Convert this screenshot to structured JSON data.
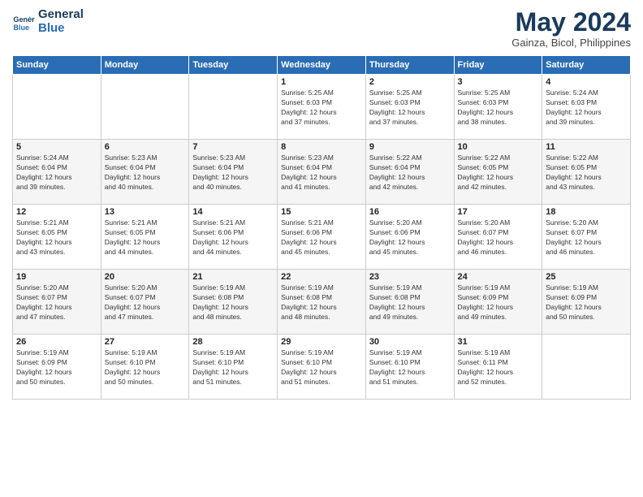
{
  "logo": {
    "line1": "General",
    "line2": "Blue"
  },
  "title": "May 2024",
  "subtitle": "Gainza, Bicol, Philippines",
  "days_header": [
    "Sunday",
    "Monday",
    "Tuesday",
    "Wednesday",
    "Thursday",
    "Friday",
    "Saturday"
  ],
  "weeks": [
    [
      {
        "day": "",
        "info": ""
      },
      {
        "day": "",
        "info": ""
      },
      {
        "day": "",
        "info": ""
      },
      {
        "day": "1",
        "info": "Sunrise: 5:25 AM\nSunset: 6:03 PM\nDaylight: 12 hours\nand 37 minutes."
      },
      {
        "day": "2",
        "info": "Sunrise: 5:25 AM\nSunset: 6:03 PM\nDaylight: 12 hours\nand 37 minutes."
      },
      {
        "day": "3",
        "info": "Sunrise: 5:25 AM\nSunset: 6:03 PM\nDaylight: 12 hours\nand 38 minutes."
      },
      {
        "day": "4",
        "info": "Sunrise: 5:24 AM\nSunset: 6:03 PM\nDaylight: 12 hours\nand 39 minutes."
      }
    ],
    [
      {
        "day": "5",
        "info": "Sunrise: 5:24 AM\nSunset: 6:04 PM\nDaylight: 12 hours\nand 39 minutes."
      },
      {
        "day": "6",
        "info": "Sunrise: 5:23 AM\nSunset: 6:04 PM\nDaylight: 12 hours\nand 40 minutes."
      },
      {
        "day": "7",
        "info": "Sunrise: 5:23 AM\nSunset: 6:04 PM\nDaylight: 12 hours\nand 40 minutes."
      },
      {
        "day": "8",
        "info": "Sunrise: 5:23 AM\nSunset: 6:04 PM\nDaylight: 12 hours\nand 41 minutes."
      },
      {
        "day": "9",
        "info": "Sunrise: 5:22 AM\nSunset: 6:04 PM\nDaylight: 12 hours\nand 42 minutes."
      },
      {
        "day": "10",
        "info": "Sunrise: 5:22 AM\nSunset: 6:05 PM\nDaylight: 12 hours\nand 42 minutes."
      },
      {
        "day": "11",
        "info": "Sunrise: 5:22 AM\nSunset: 6:05 PM\nDaylight: 12 hours\nand 43 minutes."
      }
    ],
    [
      {
        "day": "12",
        "info": "Sunrise: 5:21 AM\nSunset: 6:05 PM\nDaylight: 12 hours\nand 43 minutes."
      },
      {
        "day": "13",
        "info": "Sunrise: 5:21 AM\nSunset: 6:05 PM\nDaylight: 12 hours\nand 44 minutes."
      },
      {
        "day": "14",
        "info": "Sunrise: 5:21 AM\nSunset: 6:06 PM\nDaylight: 12 hours\nand 44 minutes."
      },
      {
        "day": "15",
        "info": "Sunrise: 5:21 AM\nSunset: 6:06 PM\nDaylight: 12 hours\nand 45 minutes."
      },
      {
        "day": "16",
        "info": "Sunrise: 5:20 AM\nSunset: 6:06 PM\nDaylight: 12 hours\nand 45 minutes."
      },
      {
        "day": "17",
        "info": "Sunrise: 5:20 AM\nSunset: 6:07 PM\nDaylight: 12 hours\nand 46 minutes."
      },
      {
        "day": "18",
        "info": "Sunrise: 5:20 AM\nSunset: 6:07 PM\nDaylight: 12 hours\nand 46 minutes."
      }
    ],
    [
      {
        "day": "19",
        "info": "Sunrise: 5:20 AM\nSunset: 6:07 PM\nDaylight: 12 hours\nand 47 minutes."
      },
      {
        "day": "20",
        "info": "Sunrise: 5:20 AM\nSunset: 6:07 PM\nDaylight: 12 hours\nand 47 minutes."
      },
      {
        "day": "21",
        "info": "Sunrise: 5:19 AM\nSunset: 6:08 PM\nDaylight: 12 hours\nand 48 minutes."
      },
      {
        "day": "22",
        "info": "Sunrise: 5:19 AM\nSunset: 6:08 PM\nDaylight: 12 hours\nand 48 minutes."
      },
      {
        "day": "23",
        "info": "Sunrise: 5:19 AM\nSunset: 6:08 PM\nDaylight: 12 hours\nand 49 minutes."
      },
      {
        "day": "24",
        "info": "Sunrise: 5:19 AM\nSunset: 6:09 PM\nDaylight: 12 hours\nand 49 minutes."
      },
      {
        "day": "25",
        "info": "Sunrise: 5:19 AM\nSunset: 6:09 PM\nDaylight: 12 hours\nand 50 minutes."
      }
    ],
    [
      {
        "day": "26",
        "info": "Sunrise: 5:19 AM\nSunset: 6:09 PM\nDaylight: 12 hours\nand 50 minutes."
      },
      {
        "day": "27",
        "info": "Sunrise: 5:19 AM\nSunset: 6:10 PM\nDaylight: 12 hours\nand 50 minutes."
      },
      {
        "day": "28",
        "info": "Sunrise: 5:19 AM\nSunset: 6:10 PM\nDaylight: 12 hours\nand 51 minutes."
      },
      {
        "day": "29",
        "info": "Sunrise: 5:19 AM\nSunset: 6:10 PM\nDaylight: 12 hours\nand 51 minutes."
      },
      {
        "day": "30",
        "info": "Sunrise: 5:19 AM\nSunset: 6:10 PM\nDaylight: 12 hours\nand 51 minutes."
      },
      {
        "day": "31",
        "info": "Sunrise: 5:19 AM\nSunset: 6:11 PM\nDaylight: 12 hours\nand 52 minutes."
      },
      {
        "day": "",
        "info": ""
      }
    ]
  ]
}
